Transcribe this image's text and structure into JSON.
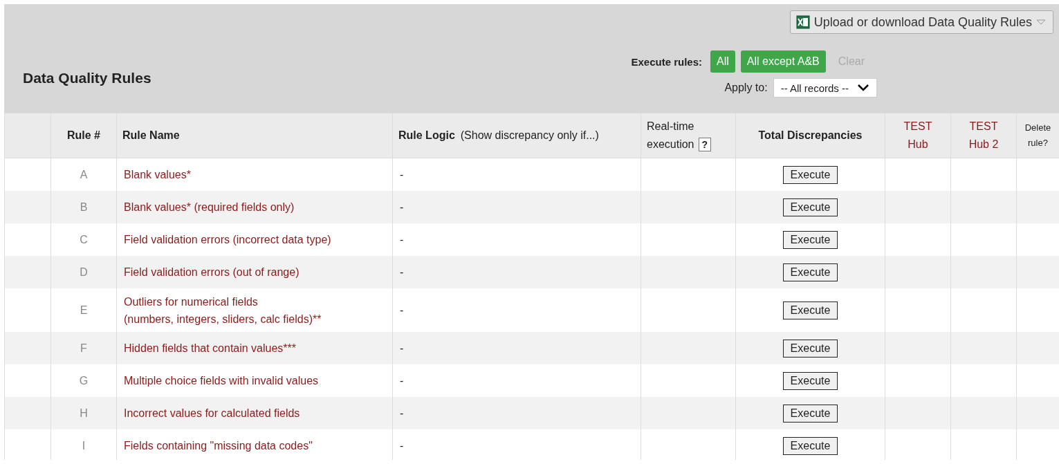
{
  "title": "Data Quality Rules",
  "upload_button": {
    "label": "Upload or download Data Quality Rules"
  },
  "execute_rules": {
    "label": "Execute rules:",
    "buttons": [
      {
        "label": "All",
        "disabled": false
      },
      {
        "label": "All except A&B",
        "disabled": false
      },
      {
        "label": "Clear",
        "disabled": true
      }
    ]
  },
  "apply_to": {
    "label": "Apply to:",
    "value": "-- All records --"
  },
  "columns": [
    {
      "kind": "plain"
    },
    {
      "kind": "bold",
      "label": "Rule #"
    },
    {
      "kind": "bold",
      "label": "Rule Name"
    },
    {
      "kind": "bold",
      "label": "Rule Logic",
      "note": "(Show discrepancy only if...)"
    },
    {
      "kind": "help",
      "label": "Real-time",
      "label2": "execution",
      "help": "?"
    },
    {
      "kind": "bold",
      "label": "Total Discrepancies"
    },
    {
      "kind": "link",
      "label": "TEST",
      "label2": "Hub"
    },
    {
      "kind": "link",
      "label": "TEST",
      "label2": "Hub 2"
    },
    {
      "kind": "small",
      "label": "Delete",
      "label2": "rule?"
    }
  ],
  "rows": [
    {
      "rule": "A",
      "name": "Blank values*",
      "logic": "-",
      "action": "Execute"
    },
    {
      "rule": "B",
      "name": "Blank values* (required fields only)",
      "logic": "-",
      "action": "Execute"
    },
    {
      "rule": "C",
      "name": "Field validation errors (incorrect data type)",
      "logic": "-",
      "action": "Execute"
    },
    {
      "rule": "D",
      "name": "Field validation errors (out of range)",
      "logic": "-",
      "action": "Execute"
    },
    {
      "rule": "E",
      "name": "Outliers for numerical fields",
      "name2": "(numbers, integers, sliders, calc fields)**",
      "logic": "-",
      "action": "Execute"
    },
    {
      "rule": "F",
      "name": "Hidden fields that contain values***",
      "logic": "-",
      "action": "Execute"
    },
    {
      "rule": "G",
      "name": "Multiple choice fields with invalid values",
      "logic": "-",
      "action": "Execute"
    },
    {
      "rule": "H",
      "name": "Incorrect values for calculated fields",
      "logic": "-",
      "action": "Execute"
    },
    {
      "rule": "I",
      "name": "Fields containing \"missing data codes\"",
      "logic": "-",
      "action": "Execute"
    }
  ]
}
